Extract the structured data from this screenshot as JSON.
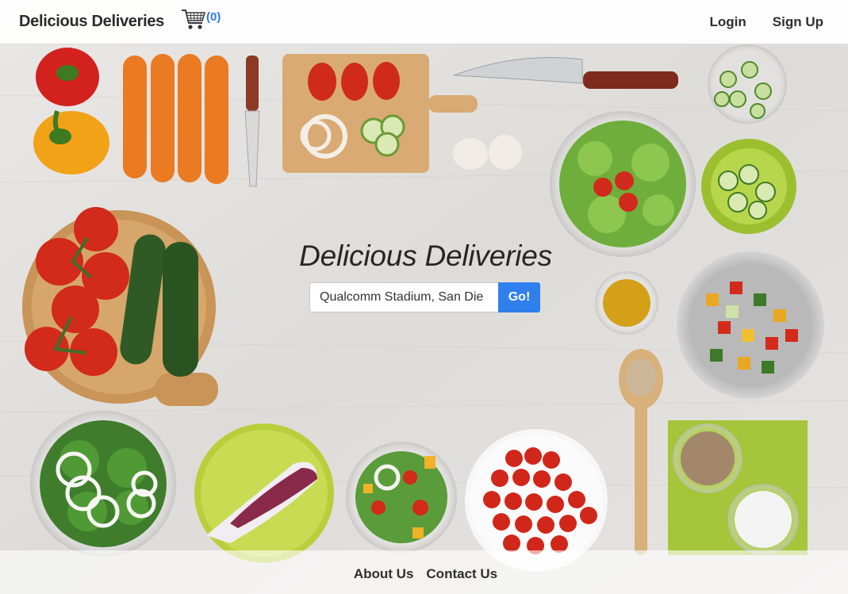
{
  "navbar": {
    "brand": "Delicious Deliveries",
    "cart_count": "(0)",
    "login_label": "Login",
    "signup_label": "Sign Up"
  },
  "hero": {
    "title": "Delicious Deliveries",
    "search_value": "Qualcomm Stadium, San Die",
    "go_label": "Go!"
  },
  "footer": {
    "about_label": "About Us",
    "contact_label": "Contact Us"
  },
  "icons": {
    "cart": "shopping-cart-icon"
  },
  "colors": {
    "accent": "#2f80ed",
    "cart_count": "#2c7be5",
    "text_dark": "#2f2f2f"
  }
}
